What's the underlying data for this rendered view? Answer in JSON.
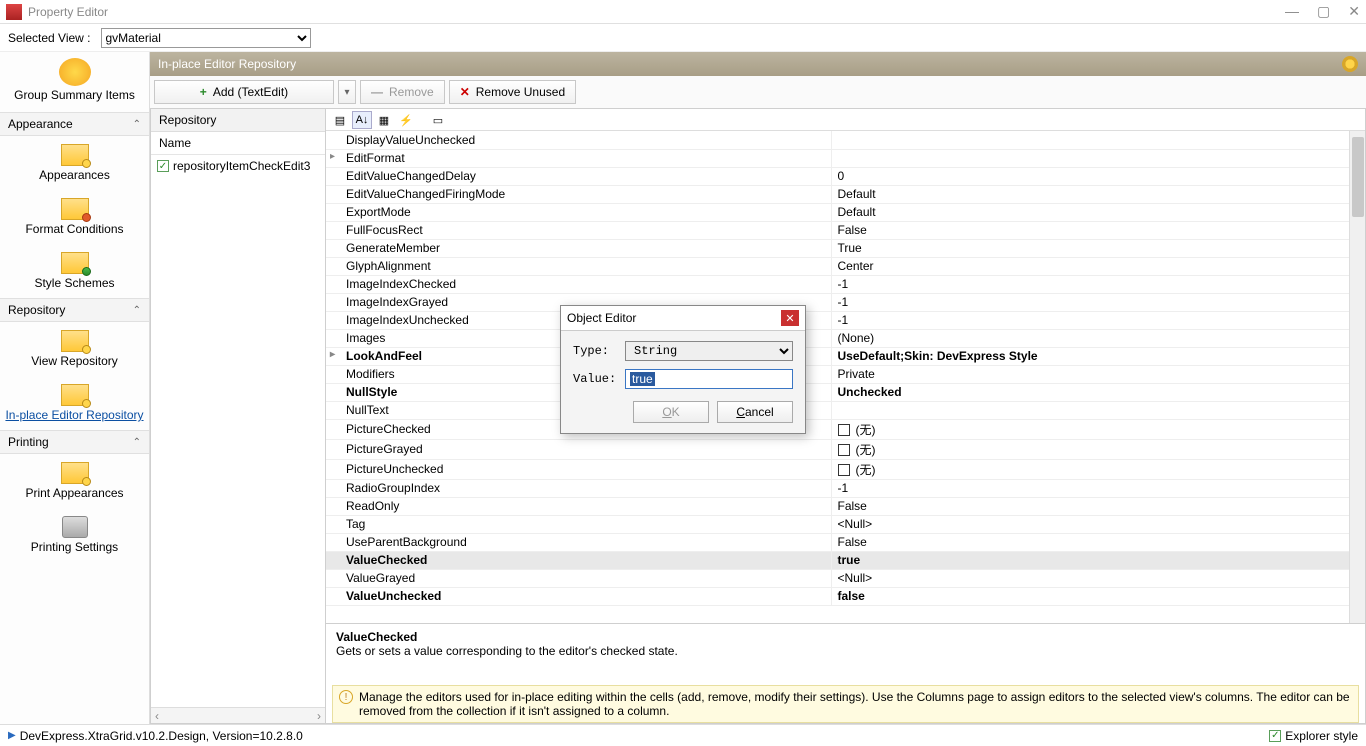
{
  "window": {
    "title": "Property Editor"
  },
  "view_row": {
    "label": "Selected View :",
    "value": "gvMaterial"
  },
  "sidebar": {
    "top_item": "Group Summary Items",
    "sections": [
      {
        "title": "Appearance",
        "items": [
          "Appearances",
          "Format Conditions",
          "Style Schemes"
        ]
      },
      {
        "title": "Repository",
        "items": [
          "View Repository",
          "In-place Editor Repository"
        ]
      },
      {
        "title": "Printing",
        "items": [
          "Print Appearances",
          "Printing Settings"
        ]
      }
    ]
  },
  "repo": {
    "header": "In-place Editor Repository",
    "toolbar": {
      "add": "Add (TextEdit)",
      "remove": "Remove",
      "remove_unused": "Remove Unused"
    },
    "panel": {
      "title": "Repository",
      "col": "Name",
      "item": "repositoryItemCheckEdit3"
    }
  },
  "properties": [
    {
      "k": "DisplayValueUnchecked",
      "v": ""
    },
    {
      "k": "EditFormat",
      "v": "",
      "expand": true
    },
    {
      "k": "EditValueChangedDelay",
      "v": "0"
    },
    {
      "k": "EditValueChangedFiringMode",
      "v": "Default"
    },
    {
      "k": "ExportMode",
      "v": "Default"
    },
    {
      "k": "FullFocusRect",
      "v": "False"
    },
    {
      "k": "GenerateMember",
      "v": "True"
    },
    {
      "k": "GlyphAlignment",
      "v": "Center"
    },
    {
      "k": "ImageIndexChecked",
      "v": "-1"
    },
    {
      "k": "ImageIndexGrayed",
      "v": "-1"
    },
    {
      "k": "ImageIndexUnchecked",
      "v": "-1"
    },
    {
      "k": "Images",
      "v": "(None)"
    },
    {
      "k": "LookAndFeel",
      "v": "UseDefault;Skin: DevExpress Style",
      "expand": true,
      "bold": true
    },
    {
      "k": "Modifiers",
      "v": "Private"
    },
    {
      "k": "NullStyle",
      "v": "Unchecked",
      "bold": true
    },
    {
      "k": "NullText",
      "v": ""
    },
    {
      "k": "PictureChecked",
      "v": "(无)",
      "pic": true
    },
    {
      "k": "PictureGrayed",
      "v": "(无)",
      "pic": true
    },
    {
      "k": "PictureUnchecked",
      "v": "(无)",
      "pic": true
    },
    {
      "k": "RadioGroupIndex",
      "v": "-1"
    },
    {
      "k": "ReadOnly",
      "v": "False"
    },
    {
      "k": "Tag",
      "v": "<Null>"
    },
    {
      "k": "UseParentBackground",
      "v": "False"
    },
    {
      "k": "ValueChecked",
      "v": "true",
      "bold": true,
      "selected": true
    },
    {
      "k": "ValueGrayed",
      "v": "<Null>"
    },
    {
      "k": "ValueUnchecked",
      "v": "false",
      "bold": true
    }
  ],
  "description": {
    "title": "ValueChecked",
    "text": "Gets or sets a value corresponding to the editor's checked state."
  },
  "hint": "Manage the editors used for in-place editing within the cells (add, remove, modify their settings). Use the Columns page to assign editors to the selected view's columns. The editor can be removed from the collection if it isn't assigned to a column.",
  "dialog": {
    "title": "Object Editor",
    "type_label": "Type:",
    "type_value": "String",
    "value_label": "Value:",
    "value_value": "true",
    "ok": "OK",
    "cancel": "Cancel"
  },
  "statusbar": {
    "left": "DevExpress.XtraGrid.v10.2.Design, Version=10.2.8.0",
    "right": "Explorer style"
  }
}
